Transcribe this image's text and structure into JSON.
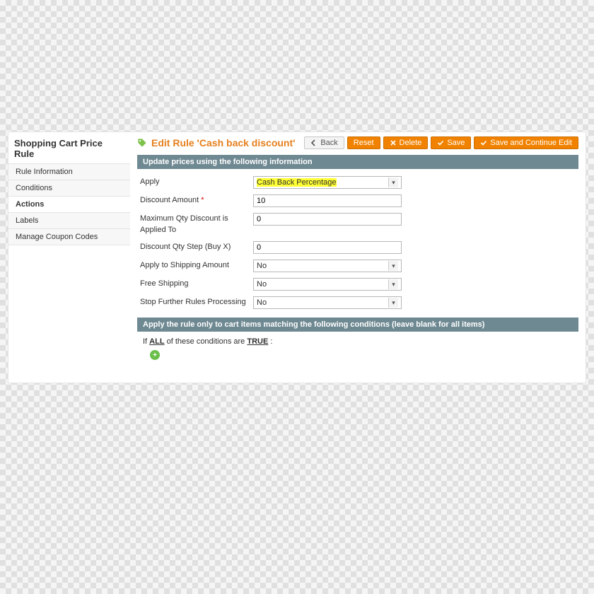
{
  "sidebar": {
    "title": "Shopping Cart Price Rule",
    "items": [
      {
        "label": "Rule Information"
      },
      {
        "label": "Conditions"
      },
      {
        "label": "Actions"
      },
      {
        "label": "Labels"
      },
      {
        "label": "Manage Coupon Codes"
      }
    ],
    "active_index": 2
  },
  "header": {
    "title": "Edit Rule 'Cash back discount'",
    "buttons": {
      "back": "Back",
      "reset": "Reset",
      "delete": "Delete",
      "save": "Save",
      "save_continue": "Save and Continue Edit"
    }
  },
  "section1": {
    "head": "Update prices using the following information",
    "fields": {
      "apply": {
        "label": "Apply",
        "value": "Cash Back Percentage"
      },
      "discount_amount": {
        "label": "Discount Amount",
        "value": "10",
        "required": true
      },
      "max_qty": {
        "label": "Maximum Qty Discount is Applied To",
        "value": "0"
      },
      "qty_step": {
        "label": "Discount Qty Step (Buy X)",
        "value": "0"
      },
      "apply_shipping": {
        "label": "Apply to Shipping Amount",
        "value": "No"
      },
      "free_shipping": {
        "label": "Free Shipping",
        "value": "No"
      },
      "stop_rules": {
        "label": "Stop Further Rules Processing",
        "value": "No"
      }
    }
  },
  "section2": {
    "head": "Apply the rule only to cart items matching the following conditions (leave blank for all items)",
    "cond_prefix": "If ",
    "cond_all": "ALL",
    "cond_mid": " of these conditions are ",
    "cond_true": "TRUE",
    "cond_suffix": " :"
  }
}
